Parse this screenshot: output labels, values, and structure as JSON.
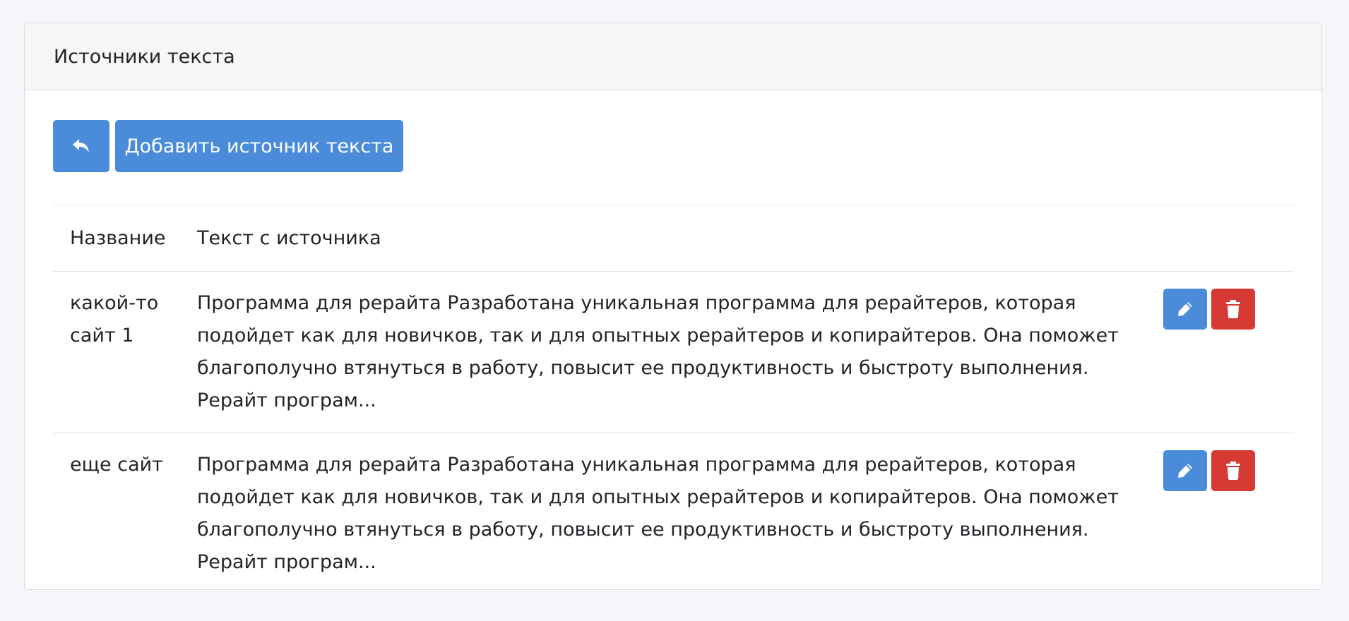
{
  "card": {
    "title": "Источники текста"
  },
  "toolbar": {
    "back_icon": "reply-icon",
    "add_label": "Добавить источник текста"
  },
  "table": {
    "headers": {
      "name": "Название",
      "text": "Текст с источника"
    },
    "rows": [
      {
        "name": "какой-то сайт 1",
        "text": "Программа для рерайта Разработана уникальная программа для рерайтеров, которая подойдет как для новичков, так и для опытных рерайтеров и копирайтеров. Она поможет благополучно втянуться в работу, повысит ее продуктивность и быстроту выполнения. Рерайт програм...",
        "edit_icon": "pencil-icon",
        "delete_icon": "trash-icon"
      },
      {
        "name": "еще сайт",
        "text": "Программа для рерайта Разработана уникальная программа для рерайтеров, которая подойдет как для новичков, так и для опытных рерайтеров и копирайтеров. Она поможет благополучно втянуться в работу, повысит ее продуктивность и быстроту выполнения. Рерайт програм...",
        "edit_icon": "pencil-icon",
        "delete_icon": "trash-icon"
      }
    ]
  },
  "colors": {
    "primary": "#4a8cd9",
    "danger": "#d63a35",
    "page_background": "#f4f6f9",
    "header_background": "#f7f7f7"
  }
}
